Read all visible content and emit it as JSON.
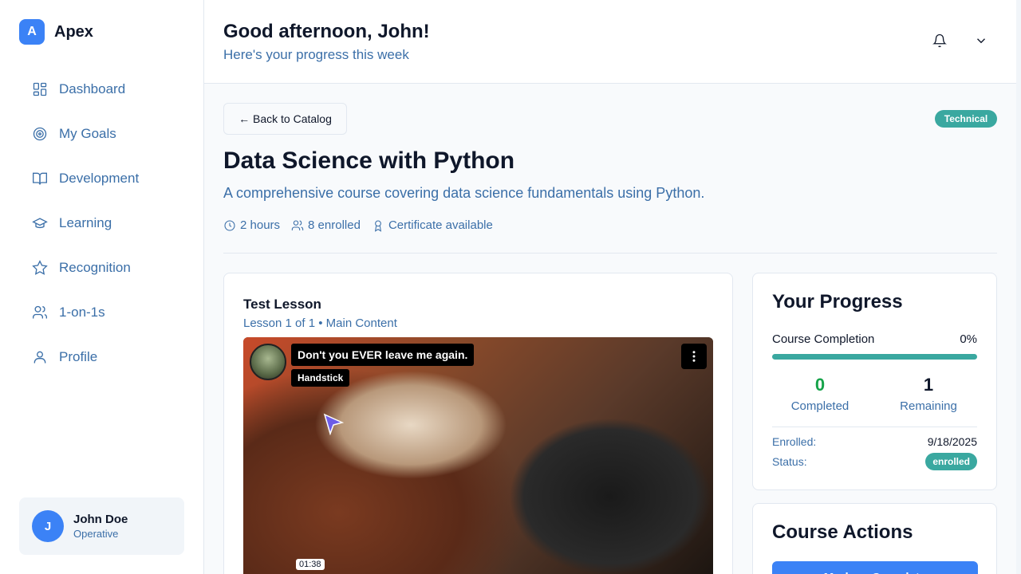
{
  "brand": {
    "logo_letter": "A",
    "name": "Apex"
  },
  "nav": [
    {
      "label": "Dashboard",
      "icon": "dashboard-icon"
    },
    {
      "label": "My Goals",
      "icon": "target-icon"
    },
    {
      "label": "Development",
      "icon": "book-icon"
    },
    {
      "label": "Learning",
      "icon": "graduation-cap-icon"
    },
    {
      "label": "Recognition",
      "icon": "star-icon"
    },
    {
      "label": "1-on-1s",
      "icon": "users-icon"
    },
    {
      "label": "Profile",
      "icon": "user-icon"
    }
  ],
  "user": {
    "initial": "J",
    "name": "John Doe",
    "role": "Operative"
  },
  "header": {
    "greeting": "Good afternoon, John!",
    "subtitle": "Here's your progress this week"
  },
  "course": {
    "back_label": "← Back to Catalog",
    "tag": "Technical",
    "title": "Data Science with Python",
    "description": "A comprehensive course covering data science fundamentals using Python.",
    "duration": "2 hours",
    "enrolled": "8 enrolled",
    "certificate": "Certificate available"
  },
  "lesson": {
    "title": "Test Lesson",
    "subtitle": "Lesson 1 of 1 • Main Content",
    "video": {
      "title": "Don't you EVER leave me again.",
      "channel": "Handstick",
      "time": "01:38"
    }
  },
  "progress": {
    "heading": "Your Progress",
    "completion_label": "Course Completion",
    "completion_value": "0%",
    "completion_fraction": 0,
    "completed_count": "0",
    "completed_label": "Completed",
    "remaining_count": "1",
    "remaining_label": "Remaining",
    "enrolled_label": "Enrolled:",
    "enrolled_date": "9/18/2025",
    "status_label": "Status:",
    "status_value": "enrolled",
    "colors": {
      "accent": "#3aa8a0",
      "completed": "#16a34a"
    }
  },
  "actions": {
    "heading": "Course Actions",
    "primary_label": "Mark as Complete"
  }
}
